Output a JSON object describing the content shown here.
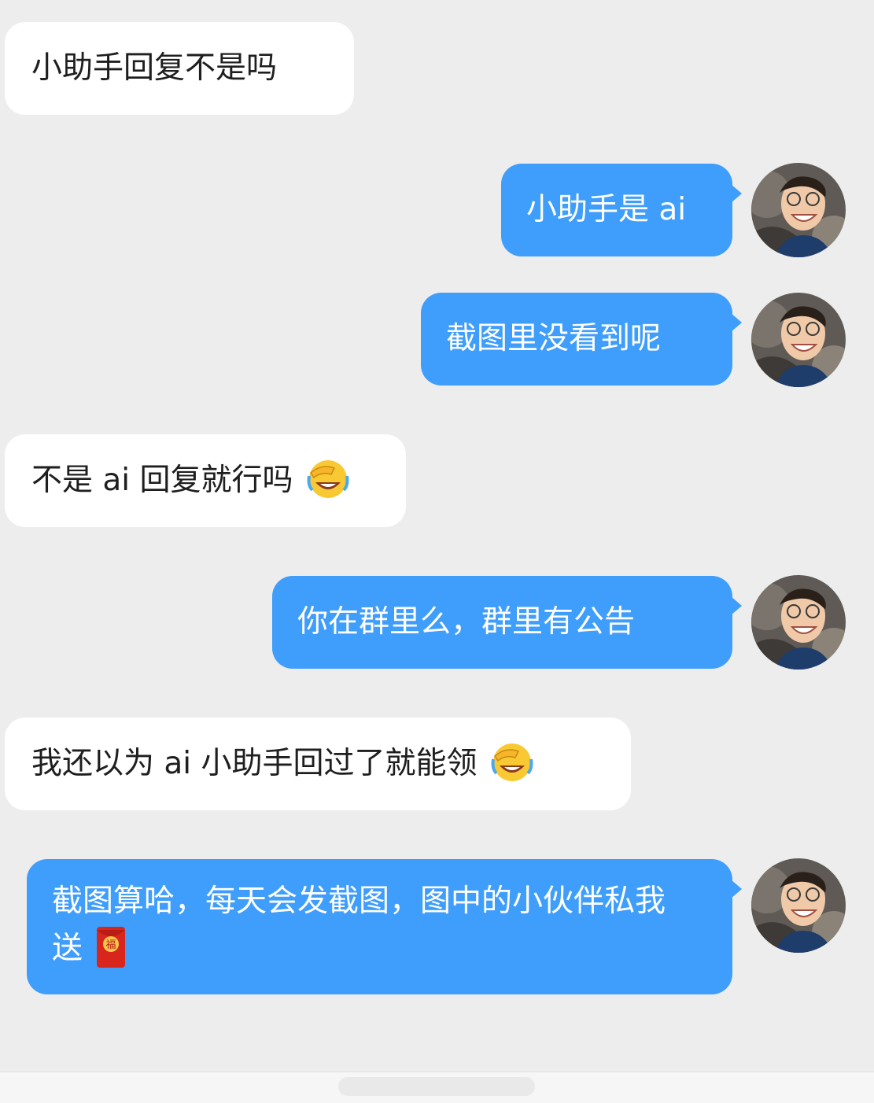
{
  "messages": [
    {
      "side": "in",
      "text": "小助手回复不是吗"
    },
    {
      "side": "out",
      "text": "小助手是 ai"
    },
    {
      "side": "out",
      "text": "截图里没看到呢"
    },
    {
      "side": "in",
      "text": "不是 ai 回复就行吗",
      "emoji": "facepalm-laugh-emoji"
    },
    {
      "side": "out",
      "text": "你在群里么，群里有公告"
    },
    {
      "side": "in",
      "text": "我还以为 ai 小助手回过了就能领",
      "emoji": "facepalm-laugh-emoji"
    },
    {
      "side": "out",
      "text": "截图算哈，每天会发截图，图中的小伙伴私我送",
      "emoji": "red-envelope-icon"
    }
  ],
  "colors": {
    "background": "#ededed",
    "incoming_bubble": "#ffffff",
    "outgoing_bubble": "#3f9efb",
    "incoming_text": "#1e1e1e",
    "outgoing_text": "#ffffff"
  }
}
